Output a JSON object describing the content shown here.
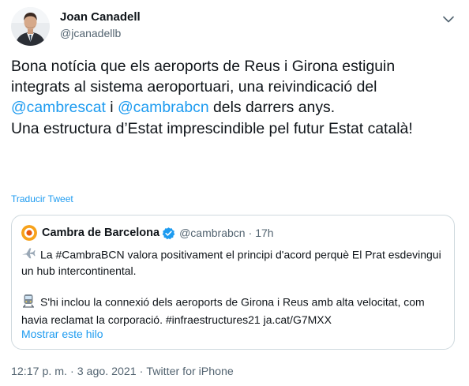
{
  "author": {
    "name": "Joan Canadell",
    "handle": "@jcanadellb"
  },
  "tweet": {
    "p1_part1": "Bona notícia que els aeroports de Reus i Girona estiguin integrats al sistema aeroportuari, una reivindicació del ",
    "mention1": "@cambrescat",
    "p1_part2": " i ",
    "mention2": "@cambrabcn",
    "p1_part3": " dels darrers anys.",
    "p2": "Una estructura d’Estat imprescindible pel futur Estat català!"
  },
  "translate_label": "Traducir Tweet",
  "quote": {
    "name": "Cambra de Barcelona",
    "handle": "@cambrabcn",
    "separator": "·",
    "time": "17h",
    "p1": "La #CambraBCN valora positivament el principi d'acord perquè El Prat esdevingui un hub intercontinental.",
    "p2": "S'hi inclou la connexió dels aeroports de Girona i Reus amb alta velocitat, com havia reclamat la corporació. #infraestructures21 ja.cat/G7MXX",
    "show_thread": "Mostrar este hilo"
  },
  "footer": {
    "time": "12:17 p. m.",
    "sep1": "·",
    "date": "3 ago. 2021",
    "sep2": "·",
    "source": "Twitter for iPhone"
  },
  "icons": {
    "more": "chevron-down-icon",
    "verified": "verified-badge-icon",
    "plane": "airplane-emoji",
    "train": "train-emoji"
  },
  "colors": {
    "accent": "#1d9bf0",
    "text": "#0f1419",
    "muted": "#536471",
    "border": "#cfd9de"
  }
}
